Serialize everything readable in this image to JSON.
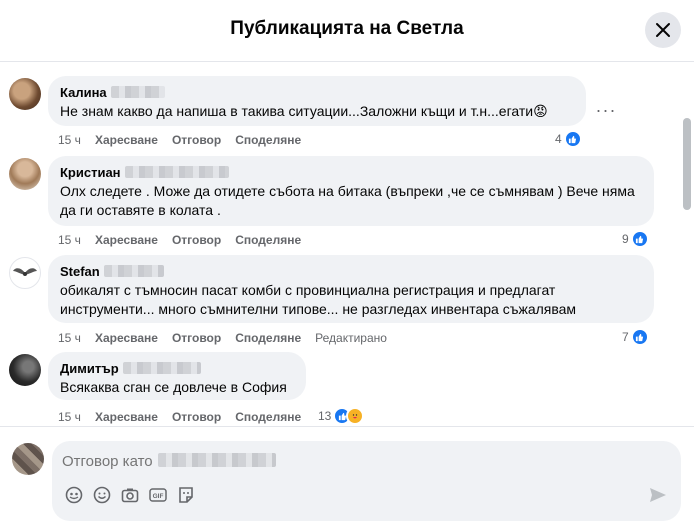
{
  "header": {
    "title": "Публикацията на Светла",
    "close_icon": "close-icon"
  },
  "actions": {
    "like": "Харесване",
    "reply": "Отговор",
    "share": "Споделяне"
  },
  "comments": [
    {
      "author": "Калина",
      "text": "Не знам какво да напиша в такива ситуации...Заложни къщи и т.н...егати😡",
      "time": "15 ч",
      "reactions": "4",
      "reaction_types": [
        "like"
      ]
    },
    {
      "author": "Кристиан",
      "text": "Олх следете . Може да отидете събота на битака (въпреки ,че се съмнявам ) Вече няма да ги оставяте в колата .",
      "time": "15 ч",
      "reactions": "9",
      "reaction_types": [
        "like"
      ]
    },
    {
      "author": "Stefan",
      "text": "обикалят с тъмносин пасат комби с провинциална регистрация и предлагат инструменти... много съмнителни типове... не разгледах инвентара съжалявам",
      "time": "15 ч",
      "reactions": "7",
      "reaction_types": [
        "like"
      ],
      "edited": "Редактирано"
    },
    {
      "author": "Димитър",
      "text": "Всякаква сган се довлече в София",
      "time": "15 ч",
      "reactions": "13",
      "reaction_types": [
        "like",
        "care"
      ]
    }
  ],
  "reply": {
    "placeholder": "Отговор като"
  },
  "colors": {
    "accent": "#1877f2",
    "bubble": "#f0f2f5",
    "meta": "#65676b"
  },
  "icons": [
    "close-icon",
    "more-options-icon",
    "like-icon",
    "care-icon",
    "avatar-icon",
    "sticker-icon",
    "emoji-icon",
    "camera-icon",
    "gif-icon",
    "sticker-pack-icon",
    "send-icon"
  ]
}
